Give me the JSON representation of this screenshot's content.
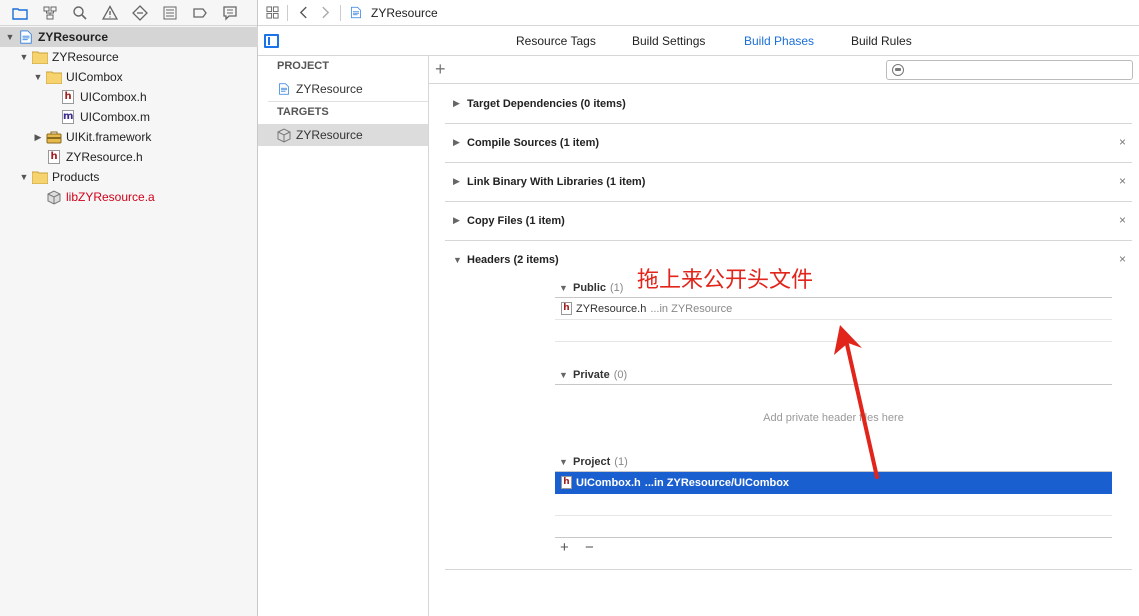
{
  "navigator": {
    "toolbar_icons": [
      "folder-icon",
      "hierarchy-icon",
      "search-icon",
      "warning-icon",
      "test-icon",
      "debug-icon",
      "breakpoint-icon",
      "report-icon"
    ],
    "tree": [
      {
        "label": "ZYResource",
        "icon": "project-icon",
        "bold": true,
        "selected": true,
        "expanded": true
      },
      {
        "label": "ZYResource",
        "icon": "folder-icon",
        "expanded": true
      },
      {
        "label": "UICombox",
        "icon": "folder-icon",
        "expanded": true
      },
      {
        "label": "UICombox.h",
        "icon": "header-file-icon",
        "glyph": "h"
      },
      {
        "label": "UICombox.m",
        "icon": "source-file-icon",
        "glyph": "m"
      },
      {
        "label": "UIKit.framework",
        "icon": "framework-icon",
        "expanded": false
      },
      {
        "label": "ZYResource.h",
        "icon": "header-file-icon",
        "glyph": "h"
      },
      {
        "label": "Products",
        "icon": "folder-icon",
        "expanded": true
      },
      {
        "label": "libZYResource.a",
        "icon": "library-icon",
        "red": true
      }
    ]
  },
  "jumpbar": {
    "title": "ZYResource"
  },
  "tabs": [
    {
      "label": "Resource Tags",
      "active": false
    },
    {
      "label": "Build Settings",
      "active": false
    },
    {
      "label": "Build Phases",
      "active": true
    },
    {
      "label": "Build Rules",
      "active": false
    }
  ],
  "target_list": {
    "project_header": "PROJECT",
    "project_item": "ZYResource",
    "targets_header": "TARGETS",
    "target_item": "ZYResource"
  },
  "main": {
    "add_symbol": "+",
    "phases": [
      {
        "title": "Target Dependencies (0 items)",
        "closable": false
      },
      {
        "title": "Compile Sources (1 item)",
        "closable": true
      },
      {
        "title": "Link Binary With Libraries (1 item)",
        "closable": true
      },
      {
        "title": "Copy Files (1 item)",
        "closable": true
      },
      {
        "title": "Headers (2 items)",
        "closable": true
      }
    ],
    "close_symbol": "×",
    "headers": {
      "public": {
        "title": "Public",
        "count": "(1)",
        "file": "ZYResource.h",
        "location": "...in ZYResource"
      },
      "private": {
        "title": "Private",
        "count": "(0)",
        "placeholder": "Add private header files here"
      },
      "project": {
        "title": "Project",
        "count": "(1)",
        "file": "UICombox.h",
        "location": "...in ZYResource/UICombox"
      }
    },
    "add_button": "+",
    "remove_button": "−"
  },
  "annotation": {
    "text": "拖上来公开头文件",
    "color": "#e1251b"
  },
  "colors": {
    "accent": "#1a6fd8",
    "selection": "#1a5fd0",
    "product_red": "#d0021b"
  }
}
